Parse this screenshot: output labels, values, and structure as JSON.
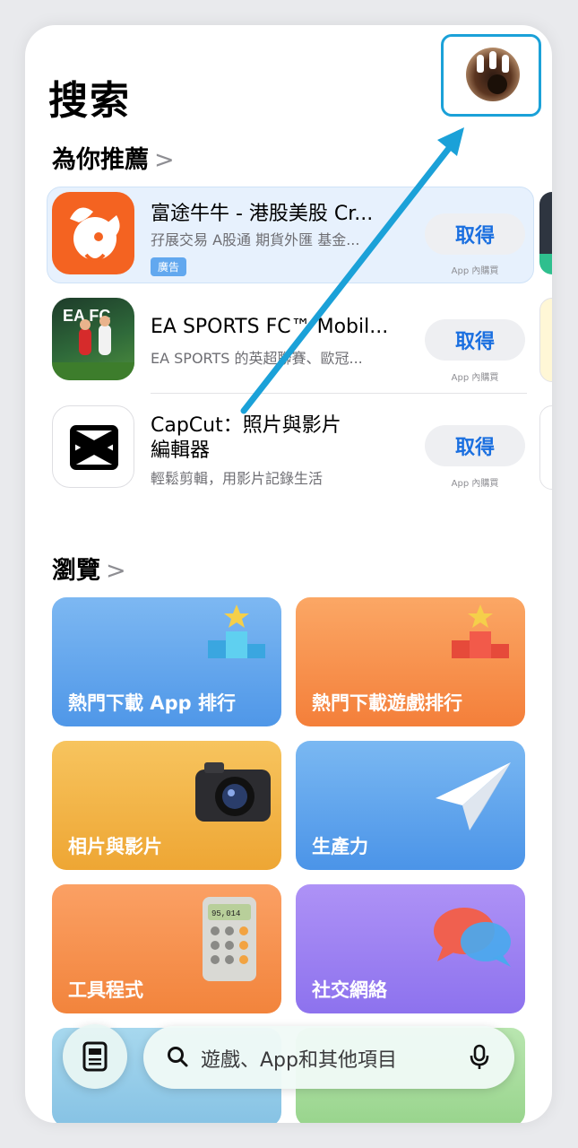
{
  "header": {
    "title": "搜索"
  },
  "recommend": {
    "heading": "為你推薦",
    "apps": [
      {
        "name": "富途牛牛 - 港股美股 Cr...",
        "subtitle": "孖展交易 A股通 期貨外匯 基金...",
        "badge": "廣告",
        "button": "取得",
        "iap": "App 內購買"
      },
      {
        "name": "EA SPORTS FC™ Mobil...",
        "subtitle": "EA SPORTS 的英超聯賽、歐冠...",
        "button": "取得",
        "iap": "App 內購買"
      },
      {
        "name_line1": "CapCut：照片與影片",
        "name_line2": "編輯器",
        "subtitle": "輕鬆剪輯，用影片記錄生活",
        "button": "取得",
        "iap": "App 內購買"
      }
    ]
  },
  "browse": {
    "heading": "瀏覽",
    "tiles": [
      {
        "label": "熱門下載 App 排行",
        "color": "#5fa4ec"
      },
      {
        "label": "熱門下載遊戲排行",
        "color": "#f7924c"
      },
      {
        "label": "相片與影片",
        "color": "#f2b13f"
      },
      {
        "label": "生產力",
        "color": "#5ea8ee"
      },
      {
        "label": "工具程式",
        "color": "#f69247"
      },
      {
        "label": "社交網絡",
        "color": "#9d82f2"
      }
    ]
  },
  "search": {
    "placeholder": "遊戲、App和其他項目"
  },
  "colors": {
    "accent": "#1a6fe0",
    "highlight": "#1ba1d8"
  }
}
